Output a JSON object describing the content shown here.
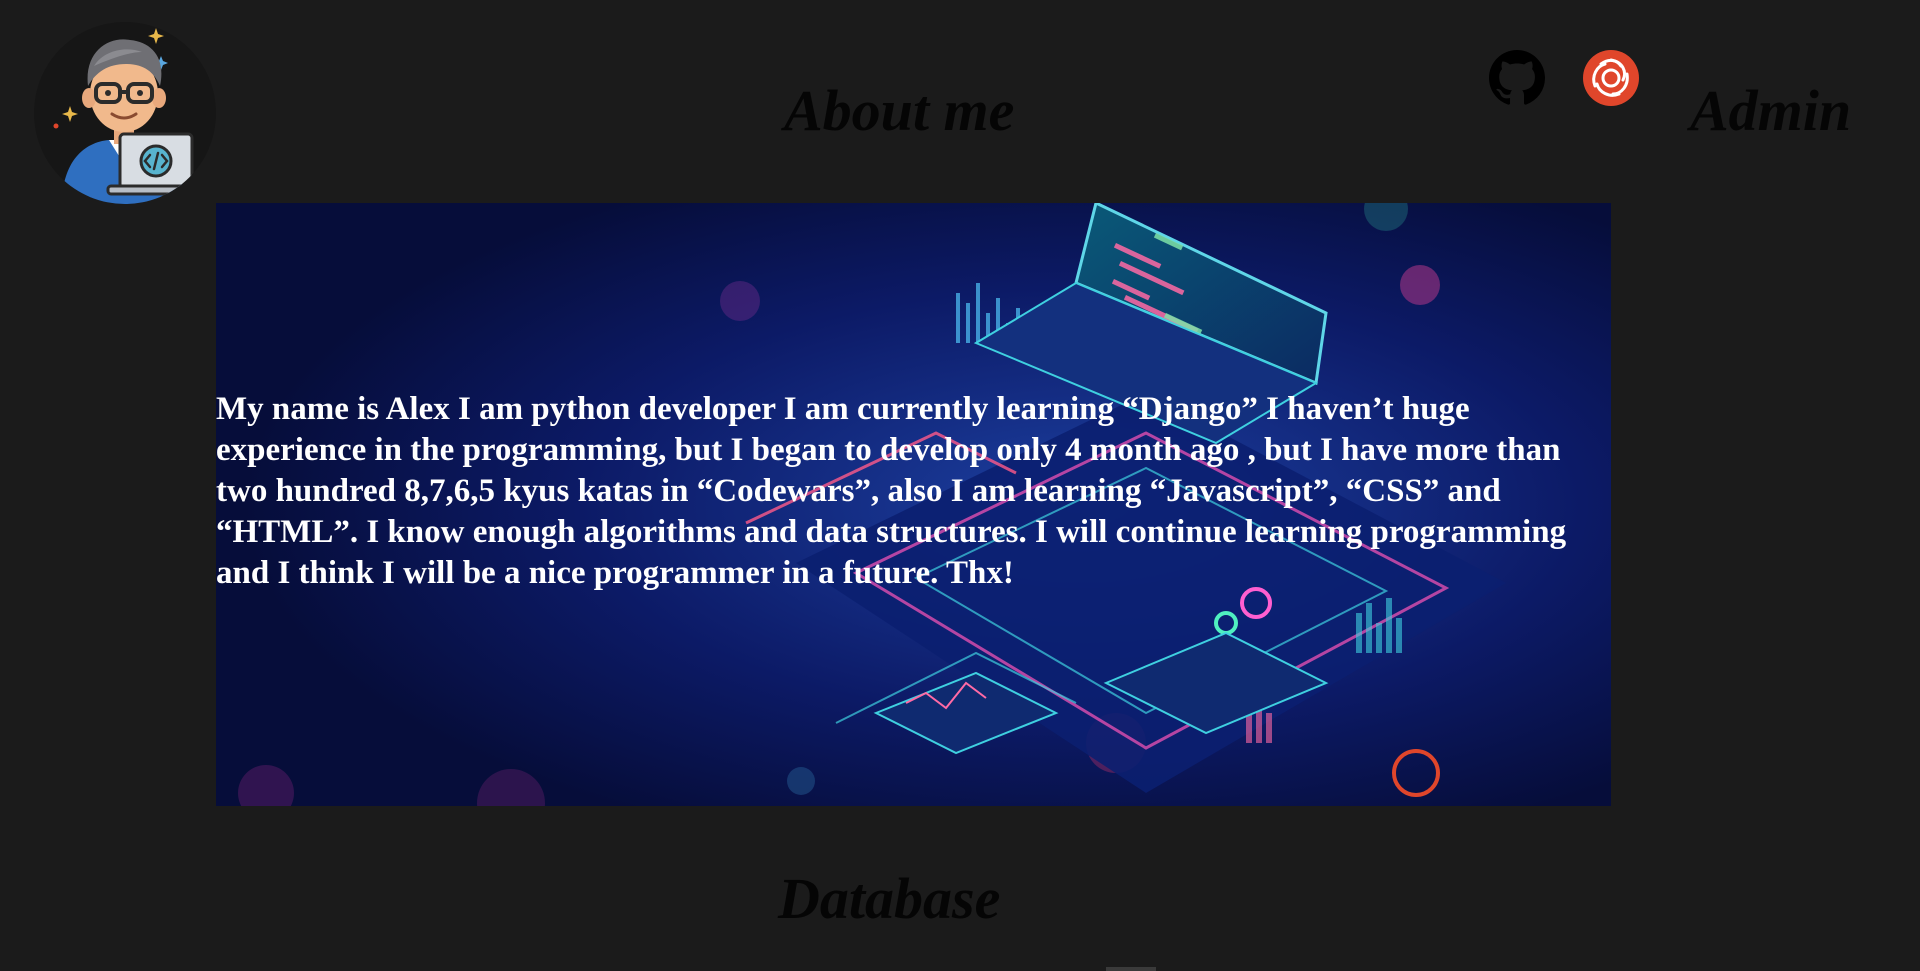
{
  "header": {
    "logo_icon": "developer-avatar-icon",
    "nav": {
      "about_label": "About me",
      "admin_label": "Admin"
    },
    "social": {
      "github_icon": "github-icon",
      "sololearn_icon": "sololearn-icon",
      "sololearn_color": "#e0462b"
    }
  },
  "hero": {
    "text": "My name is Alex I am python developer I am currently learning “Django” I haven’t huge experience in the programming, but I began to develop only 4 month ago , but I have more than two hundred 8,7,6,5 kyus katas in “Codewars”, also I am learning “Javascript”, “CSS” and “HTML”. I know enough algorithms and data structures. I will continue learning programming and I think I will be a nice programmer in a future. Thx!"
  },
  "sections": {
    "database_label": "Database"
  },
  "colors": {
    "page_background": "#1b1b1b",
    "heading_text": "#050505",
    "hero_text": "#ffffff",
    "hero_background": "#07103f"
  }
}
